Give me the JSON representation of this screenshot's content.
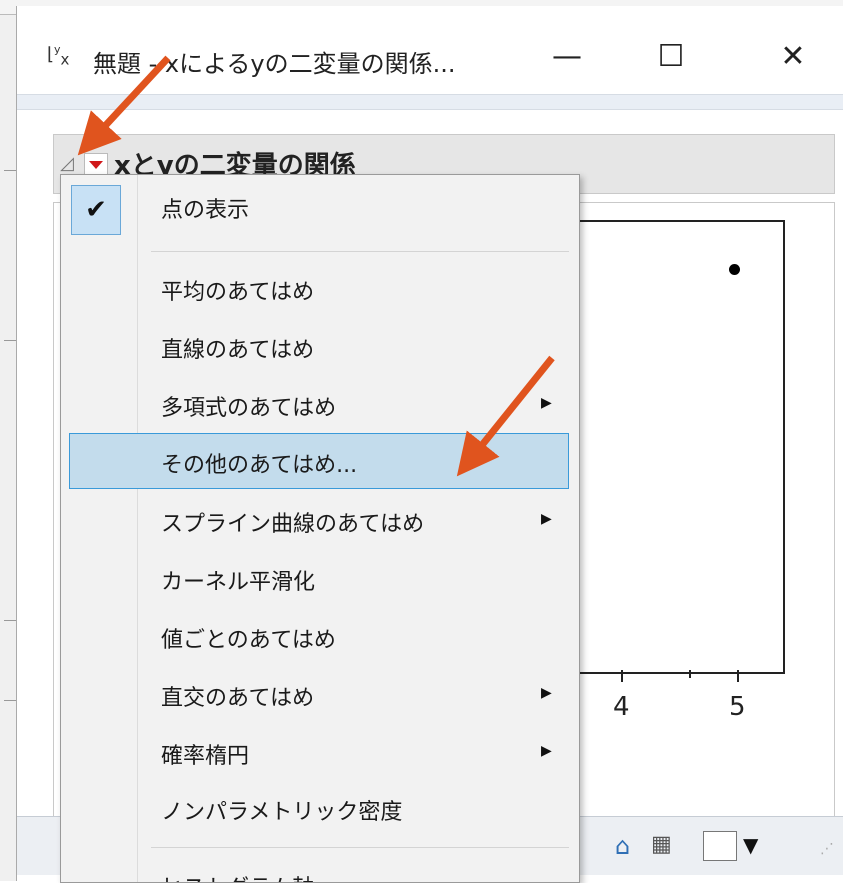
{
  "window": {
    "title": "無題 - xによるyの二変量の関係...",
    "minimize": "—",
    "maximize": "☐",
    "close": "✕",
    "icon": "yx-chart-icon"
  },
  "report": {
    "outline_title": "xとyの二変量の関係",
    "disclosure_icon": "◿",
    "x_tick_labels": [
      "4",
      "5"
    ]
  },
  "context_menu": {
    "items": [
      {
        "label": "点の表示",
        "checked": true,
        "submenu": false
      },
      {
        "label": "平均のあてはめ",
        "submenu": false
      },
      {
        "label": "直線のあてはめ",
        "submenu": false
      },
      {
        "label": "多項式のあてはめ",
        "submenu": true
      },
      {
        "label": "その他のあてはめ...",
        "submenu": false,
        "highlighted": true
      },
      {
        "label": "スプライン曲線のあてはめ",
        "submenu": true
      },
      {
        "label": "カーネル平滑化",
        "submenu": false
      },
      {
        "label": "値ごとのあてはめ",
        "submenu": false
      },
      {
        "label": "直交のあてはめ",
        "submenu": true
      },
      {
        "label": "確率楕円",
        "submenu": true
      },
      {
        "label": "ノンパラメトリック密度",
        "submenu": false
      },
      {
        "label": "ヒストグラム軸",
        "submenu": false
      }
    ],
    "check_mark": "✔",
    "submenu_arrow": "▶"
  },
  "statusbar": {
    "home_icon": "⌂",
    "save_icon": "▦",
    "dropdown_arrow": "▼",
    "grip": "⋰"
  },
  "colors": {
    "annotation_arrow": "#e0541e",
    "highlight": "#c3dcec",
    "highlight_border": "#3a9ad9",
    "red_triangle": "#d0181a"
  }
}
